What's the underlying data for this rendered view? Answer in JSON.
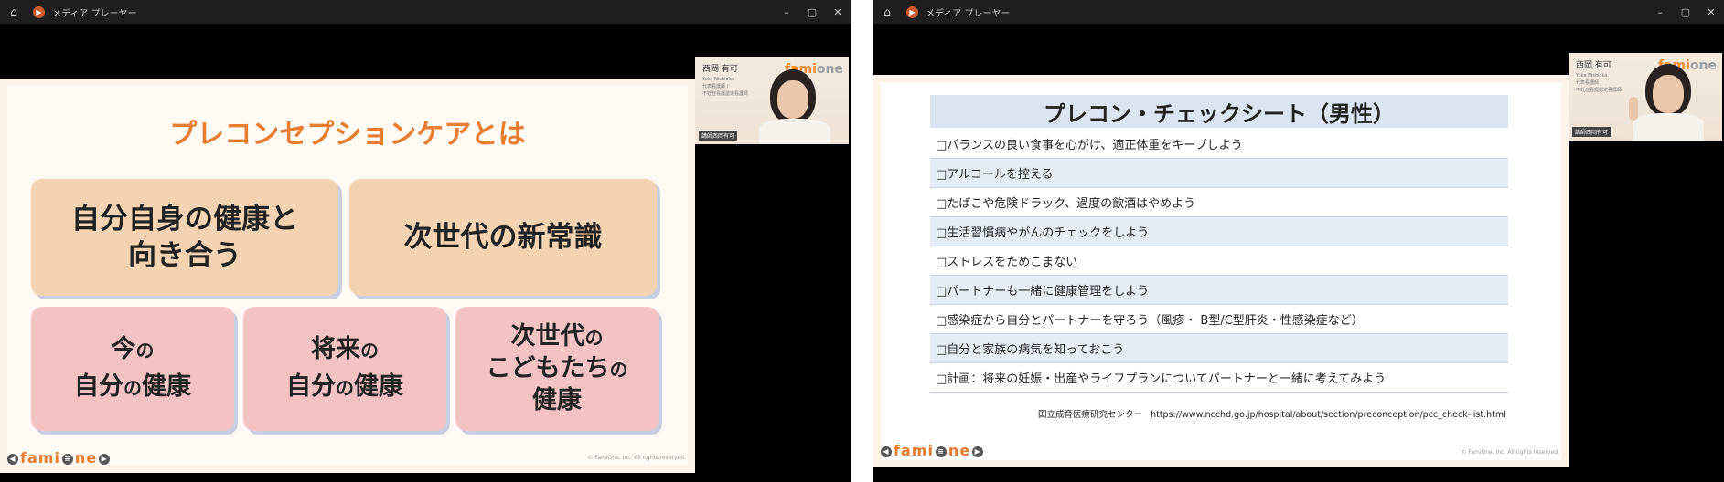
{
  "left_window": {
    "title": "メディア プレーヤー",
    "controls": {
      "minimize": "–",
      "maximize": "▢",
      "close": "✕"
    },
    "slide": {
      "heading": "プレコンセプションケアとは",
      "cards_top": [
        {
          "line1": "自分自身の健康と",
          "line2": "向き合う"
        },
        {
          "line1": "次世代の新常識",
          "line2": ""
        }
      ],
      "cards_bottom": [
        {
          "line1a": "今",
          "line1b": "の",
          "line2a": "自分",
          "line2b": "の",
          "line2c": "健康"
        },
        {
          "line1a": "将来",
          "line1b": "の",
          "line2a": "自分",
          "line2b": "の",
          "line2c": "健康"
        },
        {
          "line1a": "次世代",
          "line1b": "の",
          "line2a": "こどもたち",
          "line2b": "の",
          "line2c": "健康"
        }
      ],
      "logo_a": "fam",
      "logo_b": "i",
      "logo_c": "ne",
      "copyright": "© FamiOne, Inc. All rights reserved."
    },
    "camera": {
      "name": "西岡 有可",
      "romaji": "Yuka Nishioka",
      "role1": "代表看護師 /",
      "role2": "不妊症看護認定看護師",
      "brand_a": "fami",
      "brand_b": "one",
      "badge": "講師西岡有可"
    }
  },
  "right_window": {
    "title": "メディア プレーヤー",
    "controls": {
      "minimize": "–",
      "maximize": "▢",
      "close": "✕"
    },
    "slide": {
      "heading": "プレコン・チェックシート（男性）",
      "items": [
        "□バランスの良い食事を心がけ、適正体重をキープしよう",
        "□アルコールを控える",
        "□たばこや危険ドラック、過度の飲酒はやめよう",
        "□生活習慣病やがんのチェックをしよう",
        "□ストレスをためこまない",
        "□パートナーも一緒に健康管理をしよう",
        "□感染症から自分とパートナーを守ろう（風疹・ B型/C型肝炎・性感染症など）",
        "□自分と家族の病気を知っておこう",
        "□計画：将来の妊娠・出産やライフプランについてパートナーと一緒に考えてみよう"
      ],
      "source_org": "国立成育医療研究センター",
      "source_url": "https://www.ncchd.go.jp/hospital/about/section/preconception/pcc_check-list.html",
      "logo_a": "fam",
      "logo_b": "i",
      "logo_c": "ne",
      "copyright": "© FamiOne, Inc. All rights reserved."
    },
    "camera": {
      "name": "西岡 有可",
      "romaji": "Yuka Nishioka",
      "role1": "代表看護師 /",
      "role2": "不妊症看護認定看護師",
      "brand_a": "fami",
      "brand_b": "one",
      "badge": "講師西岡有可"
    }
  },
  "colors": {
    "heading_orange": "#e87c2f",
    "card_peach": "#f4d3b3",
    "card_pink": "#f3c2c3",
    "table_blue": "#dde4f1"
  }
}
